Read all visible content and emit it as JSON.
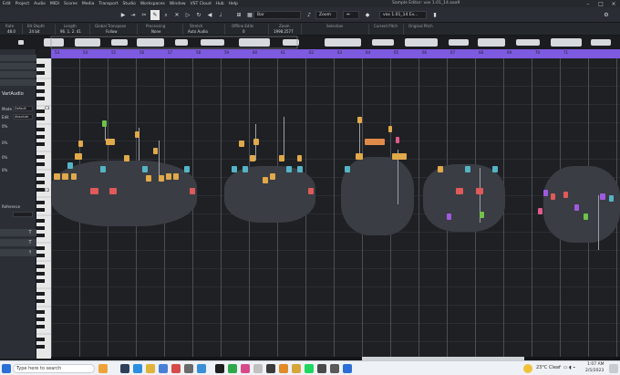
{
  "menu": [
    "Edit",
    "Project",
    "Audio",
    "MIDI",
    "Scores",
    "Media",
    "Transport",
    "Studio",
    "Workspaces",
    "Window",
    "VST Cloud",
    "Hub",
    "Help"
  ],
  "window_title": "Sample Editor: vox 1.01_14.aaa9",
  "toolbar": {
    "snap_value": "Bar",
    "zoom_label": "Zoom",
    "event_name": "vox 1.01_14 Ev..."
  },
  "info": [
    {
      "h": "Rate",
      "v": "48.0"
    },
    {
      "h": "Bit Depth",
      "v": "24 bit"
    },
    {
      "h": "Length",
      "v": "96. 1. 2. 41"
    },
    {
      "h": "Global Transpose",
      "v": "Follow"
    },
    {
      "h": "Processing",
      "v": "None"
    },
    {
      "h": "Stretch",
      "v": "Auto Audio"
    },
    {
      "h": "Offline Edits",
      "v": "0"
    },
    {
      "h": "Zoom",
      "v": "1998.2577"
    },
    {
      "h": "Selection",
      "v": ""
    },
    {
      "h": "Current Pitch",
      "v": ""
    },
    {
      "h": "Original Pitch",
      "v": ""
    }
  ],
  "ruler": [
    "53",
    "54",
    "55",
    "56",
    "57",
    "58",
    "59",
    "60",
    "61",
    "62",
    "63",
    "64",
    "65",
    "66",
    "67",
    "68",
    "69",
    "70",
    "71"
  ],
  "inspector": {
    "title": "VariAudio",
    "mode_label": "Default",
    "mode_value": "Default",
    "edit_label": "Edit",
    "edit_value": "Absolute",
    "reference": "Reference",
    "pct1": "0%",
    "pct2": "0%",
    "pct3": "0%",
    "pct4": "0%"
  },
  "keys": [
    "C3",
    "C2"
  ],
  "taskbar": {
    "search_placeholder": "Type here to search",
    "weather": "23°C Clear",
    "time": "1:07 AM",
    "date": "2/5/2023"
  },
  "colors": {
    "ruler": "#7d5ae0",
    "accent": "#e0a94a"
  }
}
